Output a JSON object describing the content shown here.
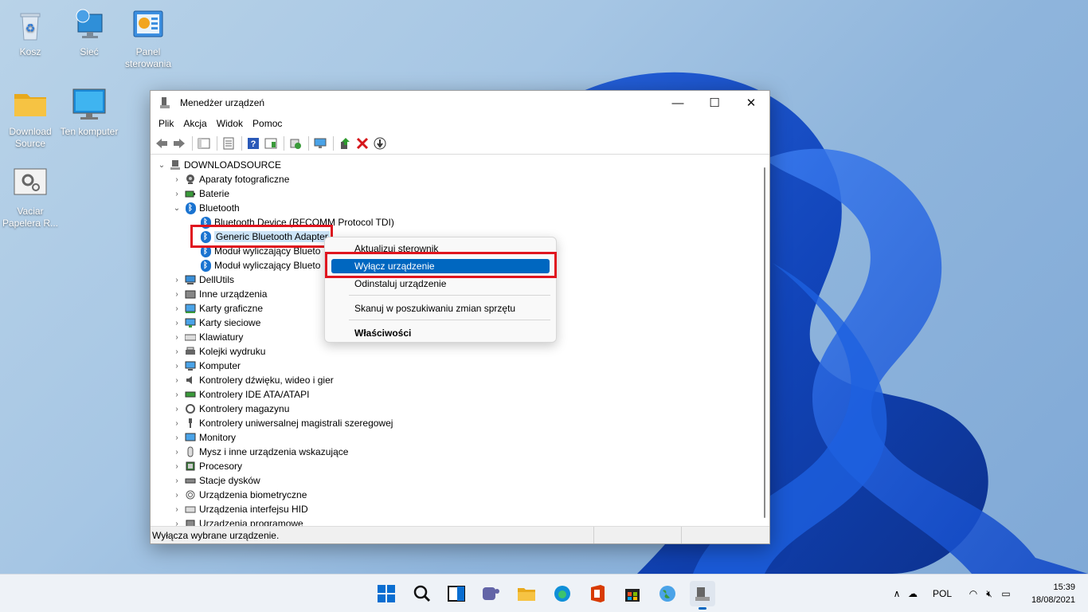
{
  "desktop": {
    "icons": [
      {
        "label": "Kosz",
        "icon": "recycle-bin-icon"
      },
      {
        "label": "Sieć",
        "icon": "network-icon"
      },
      {
        "label": "Panel sterowania",
        "icon": "control-panel-icon"
      },
      {
        "label": "Download Source",
        "icon": "folder-icon"
      },
      {
        "label": "Ten komputer",
        "icon": "computer-icon"
      },
      {
        "label": "Vaciar Papelera R...",
        "icon": "settings-shortcut-icon"
      }
    ]
  },
  "window": {
    "title": "Menedżer urządzeń",
    "controls": {
      "minimize": "—",
      "maximize": "☐",
      "close": "✕"
    },
    "menu": [
      "Plik",
      "Akcja",
      "Widok",
      "Pomoc"
    ],
    "tree": {
      "root": "DOWNLOADSOURCE",
      "items": [
        {
          "label": "Aparaty fotograficzne",
          "icon": "camera-icon"
        },
        {
          "label": "Baterie",
          "icon": "battery-icon"
        },
        {
          "label": "Bluetooth",
          "icon": "bluetooth-icon",
          "expanded": true
        },
        {
          "label": "DellUtils",
          "icon": "device-icon"
        },
        {
          "label": "Inne urządzenia",
          "icon": "unknown-device-icon"
        },
        {
          "label": "Karty graficzne",
          "icon": "display-adapter-icon"
        },
        {
          "label": "Karty sieciowe",
          "icon": "network-adapter-icon"
        },
        {
          "label": "Klawiatury",
          "icon": "keyboard-icon"
        },
        {
          "label": "Kolejki wydruku",
          "icon": "printer-icon"
        },
        {
          "label": "Komputer",
          "icon": "computer-icon"
        },
        {
          "label": "Kontrolery dźwięku, wideo i gier",
          "icon": "sound-icon"
        },
        {
          "label": "Kontrolery IDE ATA/ATAPI",
          "icon": "ide-icon"
        },
        {
          "label": "Kontrolery magazynu",
          "icon": "storage-icon"
        },
        {
          "label": "Kontrolery uniwersalnej magistrali szeregowej",
          "icon": "usb-icon"
        },
        {
          "label": "Monitory",
          "icon": "monitor-icon"
        },
        {
          "label": "Mysz i inne urządzenia wskazujące",
          "icon": "mouse-icon"
        },
        {
          "label": "Procesory",
          "icon": "cpu-icon"
        },
        {
          "label": "Stacje dysków",
          "icon": "disk-icon"
        },
        {
          "label": "Urządzenia biometryczne",
          "icon": "fingerprint-icon"
        },
        {
          "label": "Urządzenia interfejsu HID",
          "icon": "hid-icon"
        },
        {
          "label": "Urządzenia programowe",
          "icon": "software-device-icon"
        }
      ],
      "bluetooth_children": [
        "Bluetooth Device (RFCOMM Protocol TDI)",
        "Generic Bluetooth Adapter",
        "Moduł wyliczający Blueto",
        "Moduł wyliczający Blueto"
      ]
    },
    "status": "Wyłącza wybrane urządzenie."
  },
  "context_menu": {
    "items": [
      {
        "label": "Aktualizuj sterownik"
      },
      {
        "label": "Wyłącz urządzenie",
        "highlighted": true
      },
      {
        "label": "Odinstaluj urządzenie"
      },
      {
        "label": "Skanuj w poszukiwaniu zmian sprzętu"
      },
      {
        "label": "Właściwości",
        "bold": true
      }
    ]
  },
  "taskbar": {
    "apps": [
      "start-icon",
      "search-icon",
      "task-view-icon",
      "teams-icon",
      "file-explorer-icon",
      "edge-icon",
      "office-icon",
      "store-icon",
      "globe-app-icon",
      "device-manager-icon"
    ],
    "tray": {
      "language": "POL",
      "time": "15:39",
      "date": "18/08/2021"
    }
  },
  "colors": {
    "accent": "#0067c0",
    "highlight_box": "#e0151f"
  }
}
